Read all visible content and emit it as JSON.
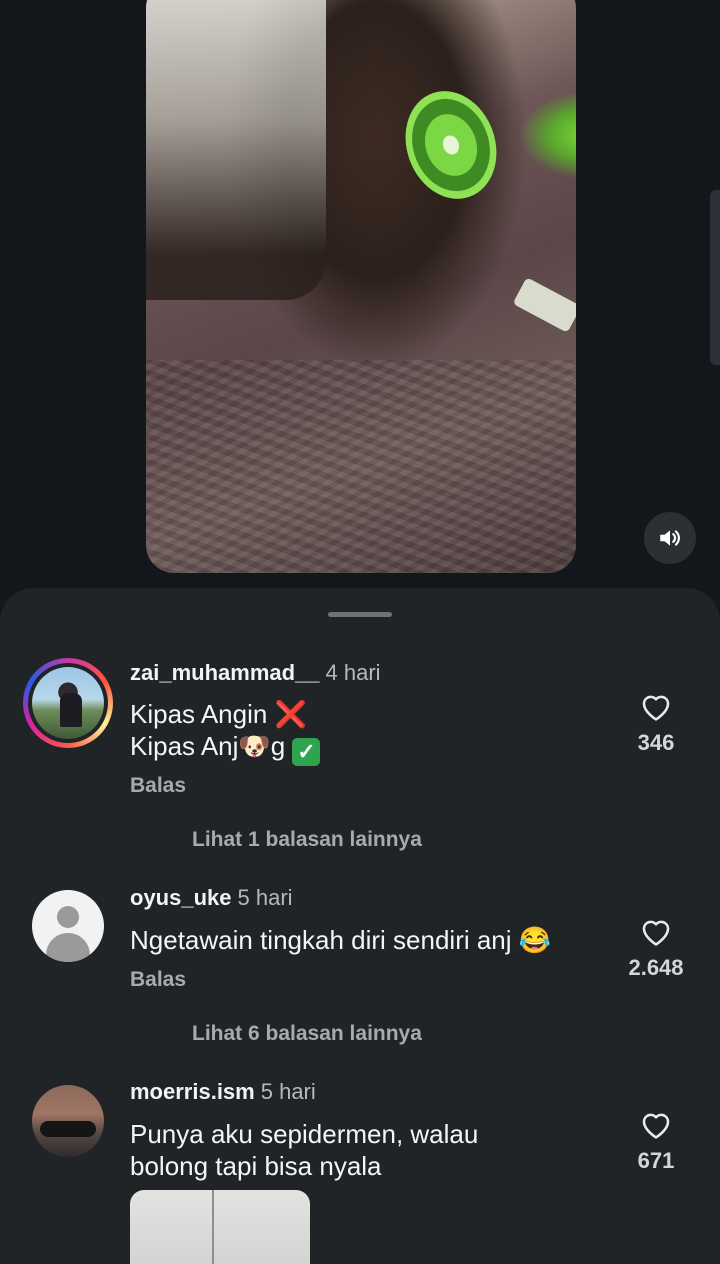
{
  "video": {
    "sound_icon": "speaker-volume-icon"
  },
  "comments": [
    {
      "username": "zai_muhammad__",
      "time": "4 hari",
      "line1": "Kipas Angin",
      "line1_emoji": "❌",
      "line2_a": "Kipas Anj",
      "line2_emoji": "🐶",
      "line2_b": "g",
      "line2_check": "✓",
      "reply": "Balas",
      "likes": "346",
      "more_replies": "Lihat 1 balasan lainnya"
    },
    {
      "username": "oyus_uke",
      "time": "5 hari",
      "text": "Ngetawain tingkah diri sendiri anj",
      "emoji": "😂",
      "reply": "Balas",
      "likes": "2.648",
      "more_replies": "Lihat 6 balasan lainnya"
    },
    {
      "username": "moerris.ism",
      "time": "5 hari",
      "line1": "Punya aku sepidermen, walau",
      "line2": "bolong tapi bisa nyala",
      "likes": "671"
    }
  ]
}
